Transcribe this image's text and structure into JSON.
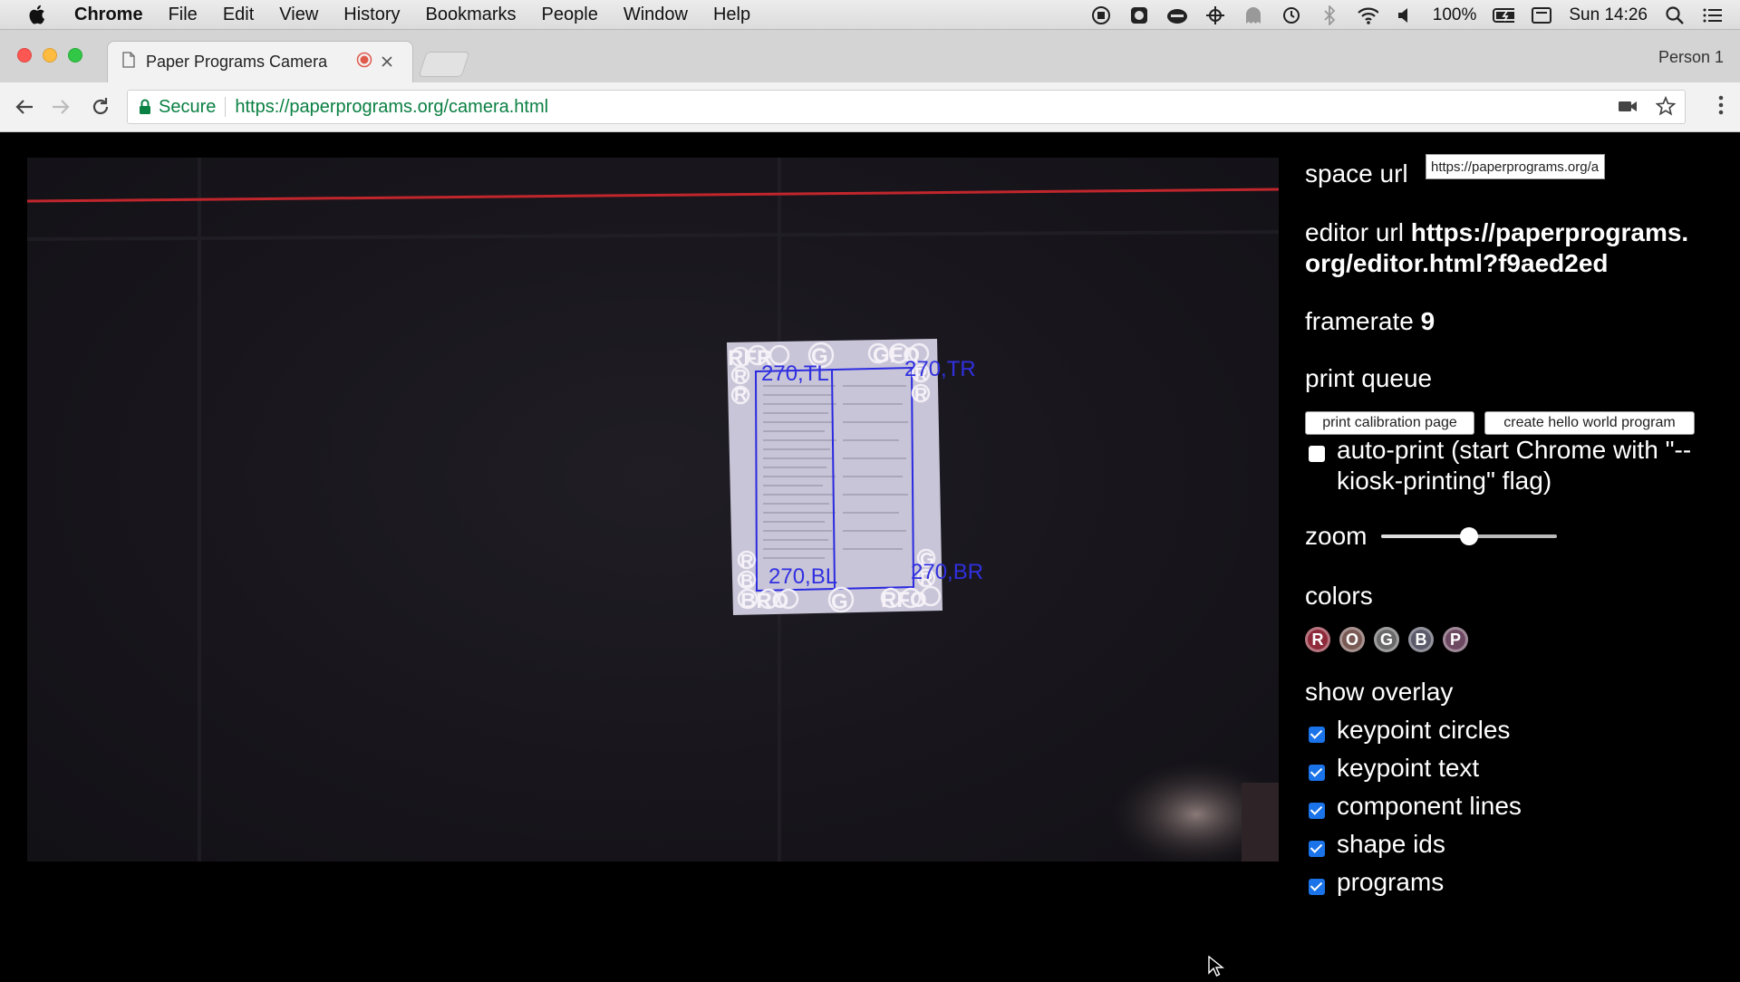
{
  "menubar": {
    "app_name": "Chrome",
    "items": [
      "File",
      "Edit",
      "View",
      "History",
      "Bookmarks",
      "People",
      "Window",
      "Help"
    ],
    "battery": "100%",
    "clock": "Sun 14:26"
  },
  "tabs": {
    "active_title": "Paper Programs Camera",
    "person": "Person 1"
  },
  "omnibox": {
    "secure_label": "Secure",
    "url": "https://paperprograms.org/camera.html"
  },
  "camera": {
    "labels": {
      "tl": "270,TL",
      "tr": "270,TR",
      "bl": "270,BL",
      "br": "270,BR"
    },
    "marker_text": {
      "top_left": "RFR",
      "top_right": "GFO",
      "bottom_left": "BRO",
      "bottom_right": "RFO",
      "left_top": "RR",
      "right_top": "RR",
      "left_bottom": "RB",
      "right_bottom": "GR",
      "top_mid": "G",
      "bottom_mid": "G"
    }
  },
  "panel": {
    "space_url_label": "space url",
    "space_url_value": "https://paperprograms.org/api/spaces/",
    "editor_url_label": "editor url",
    "editor_url_value": "https://paperprograms.org/editor.html?f9aed2ed",
    "framerate_label": "framerate",
    "framerate_value": "9",
    "print_queue_label": "print queue",
    "print_calibration_button": "print calibration page",
    "create_hello_world_button": "create hello world program",
    "auto_print_label": "auto-print (start Chrome with \"--kiosk-printing\" flag)",
    "auto_print_checked": false,
    "zoom_label": "zoom",
    "zoom_level": 0.5,
    "colors_label": "colors",
    "colors": [
      {
        "letter": "R",
        "color": "#8e2a3a"
      },
      {
        "letter": "O",
        "color": "#7a5a55"
      },
      {
        "letter": "G",
        "color": "#6a6a6a"
      },
      {
        "letter": "B",
        "color": "#5a5a6a"
      },
      {
        "letter": "P",
        "color": "#6e4a62"
      }
    ],
    "show_overlay_label": "show overlay",
    "overlays": [
      {
        "label": "keypoint circles",
        "checked": true
      },
      {
        "label": "keypoint text",
        "checked": true
      },
      {
        "label": "component lines",
        "checked": true
      },
      {
        "label": "shape ids",
        "checked": true
      },
      {
        "label": "programs",
        "checked": true
      }
    ]
  }
}
